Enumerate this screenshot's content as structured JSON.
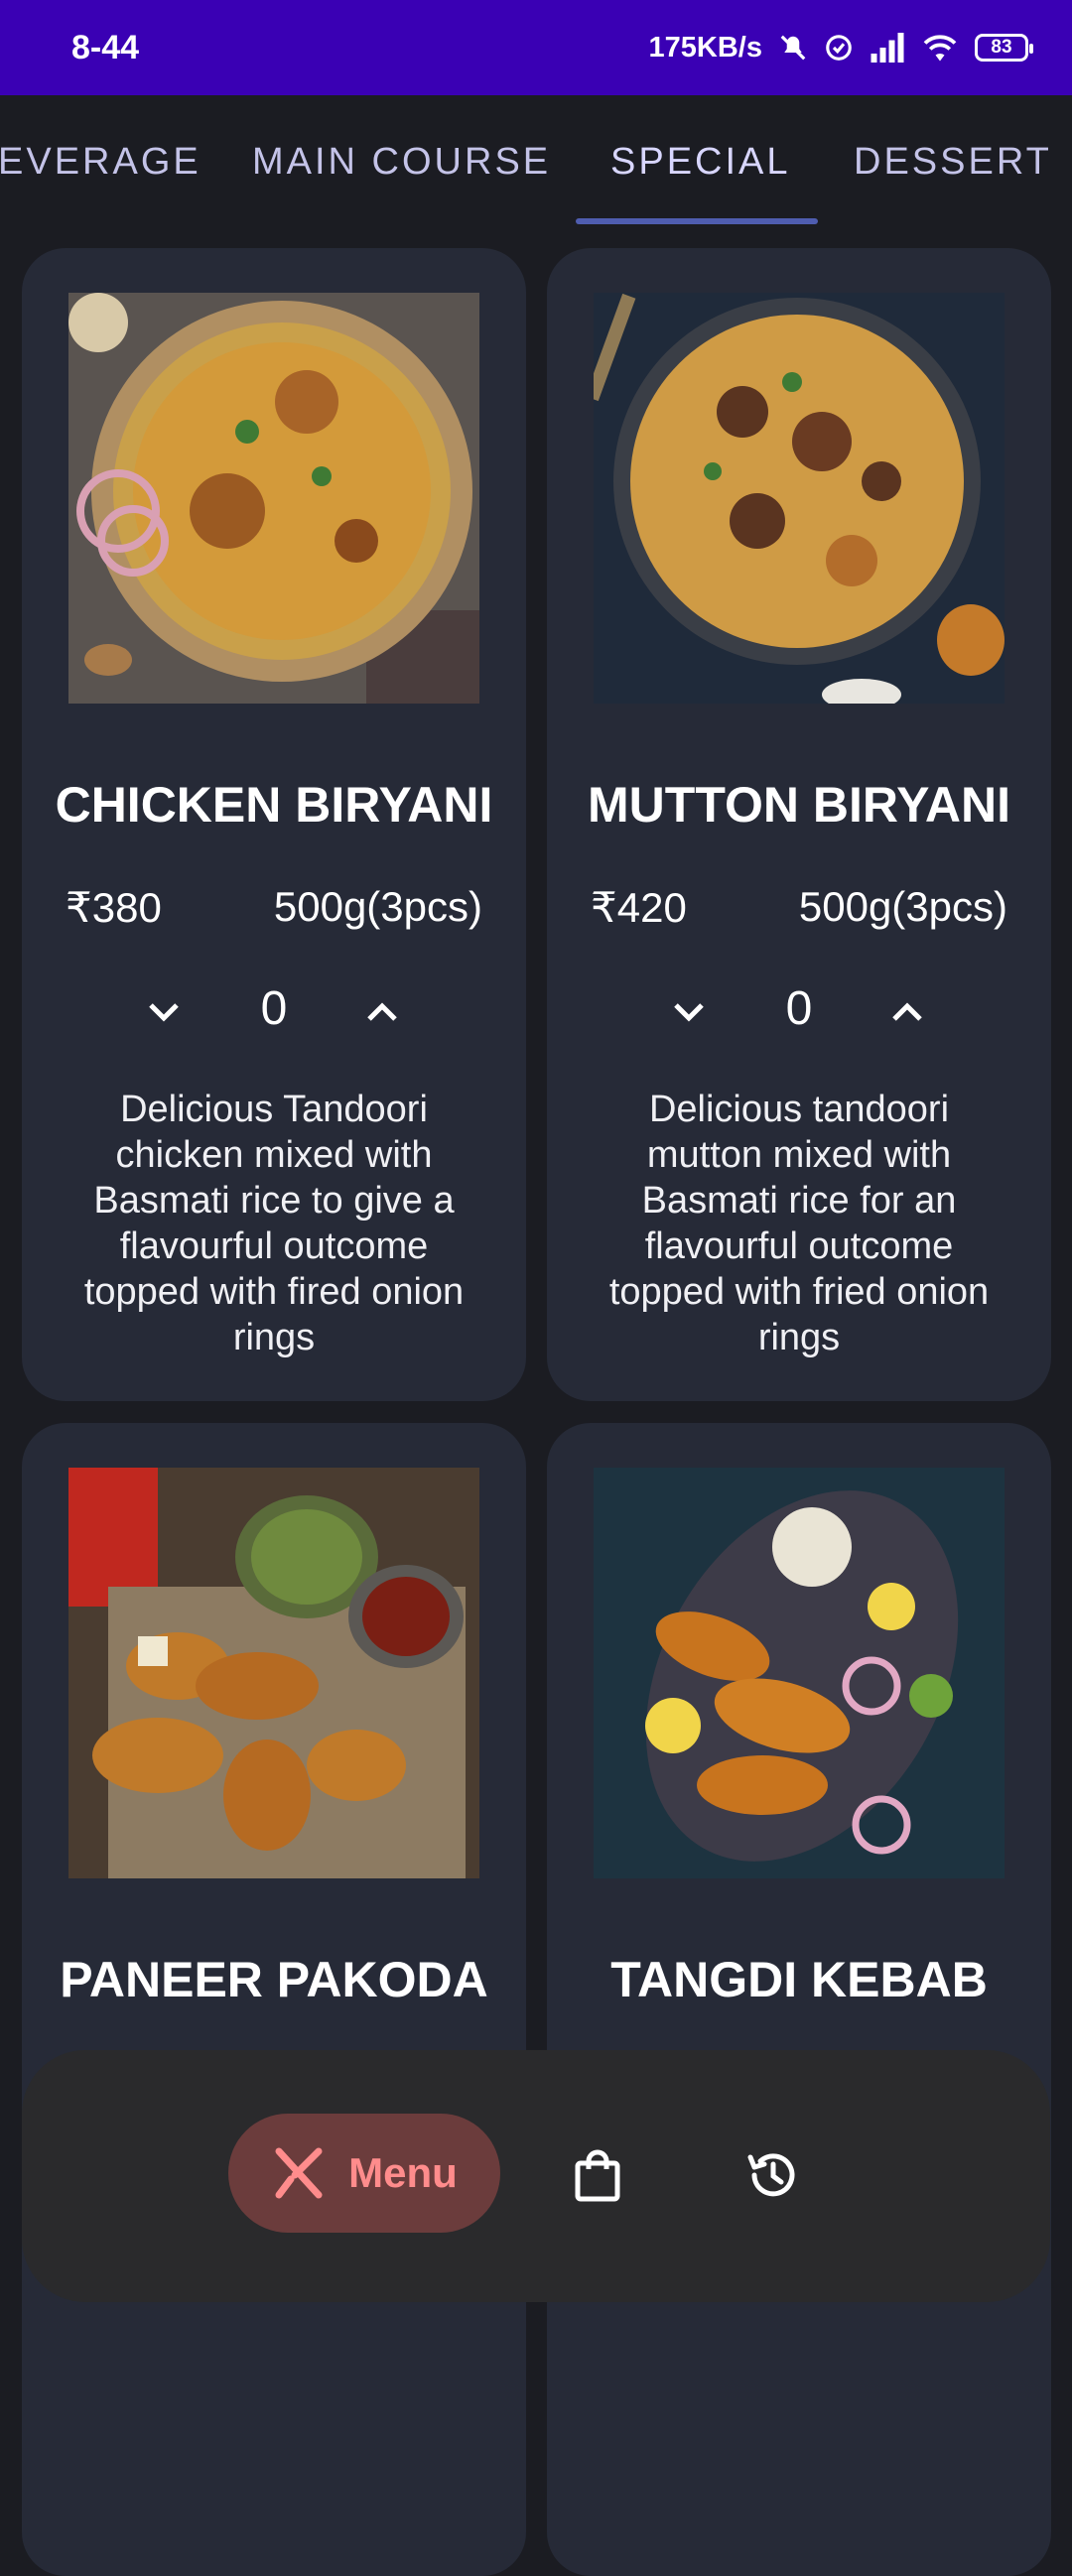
{
  "status_bar": {
    "time": "8-44",
    "network_speed": "175KB/s",
    "battery": "83"
  },
  "tabs": [
    {
      "label": "EVERAGE",
      "active": false
    },
    {
      "label": "MAIN COURSE",
      "active": false
    },
    {
      "label": "SPECIAL",
      "active": true
    },
    {
      "label": "DESSERT",
      "active": false
    }
  ],
  "items": [
    {
      "name": "CHICKEN BIRYANI",
      "price": "₹380",
      "weight": "500g(3pcs)",
      "quantity": "0",
      "description": "Delicious Tandoori chicken mixed with Basmati rice to give a flavourful outcome topped with fired onion rings",
      "image": "chicken-biryani-photo"
    },
    {
      "name": "MUTTON BIRYANI",
      "price": "₹420",
      "weight": "500g(3pcs)",
      "quantity": "0",
      "description": "Delicious tandoori mutton mixed with Basmati rice for an flavourful outcome topped with fried onion rings",
      "image": "mutton-biryani-photo"
    },
    {
      "name": "PANEER PAKODA",
      "image": "paneer-pakoda-photo"
    },
    {
      "name": "TANGDI KEBAB",
      "image": "tangdi-kebab-photo"
    }
  ],
  "bottom_nav": {
    "menu_label": "Menu",
    "icons": [
      "restaurant-icon",
      "shopping-bag-icon",
      "history-icon"
    ],
    "accent_color": "#ff8c8c"
  },
  "colors": {
    "status_bar": "#3a00b4",
    "background": "#1b1c22",
    "card": "#262a37",
    "tab_indicator": "#4f5db0"
  }
}
